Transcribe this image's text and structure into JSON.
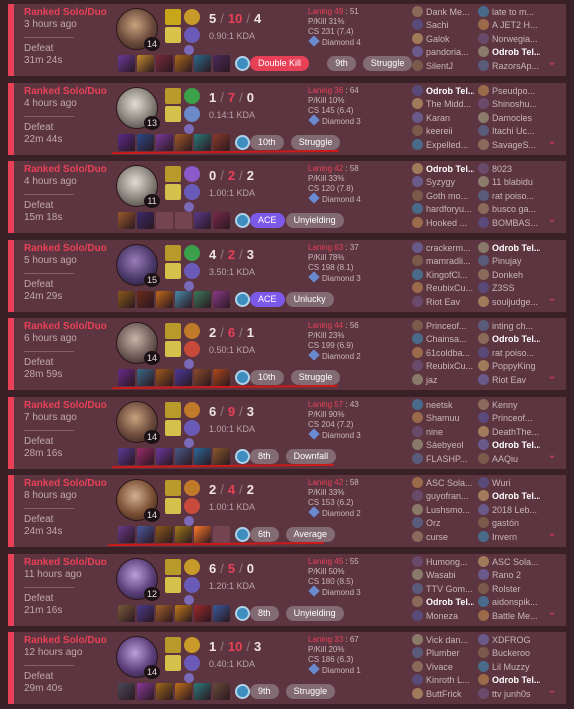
{
  "colors": {
    "loss_accent": "#e84057",
    "card_bg": "#5d3540",
    "ace_badge": "#7d59ea",
    "multikill_badge": "#e84057",
    "neutral_badge": "#826b72",
    "ward": "#3d8dbf",
    "annotation": "#cc1a1a"
  },
  "icons": {
    "expand": "chevron-down-icon",
    "ward": "ward-icon",
    "champion": "champion-portrait"
  },
  "matches": [
    {
      "queue": "Ranked Solo/Duo",
      "ago": "3 hours ago",
      "result": "Defeat",
      "duration": "31m 24s",
      "level": "14",
      "k": "5",
      "d": "10",
      "a": "4",
      "kda_ratio": "0.90:1 KDA",
      "laning_label": "Laning",
      "laning_a": "49",
      "laning_b": "51",
      "pkill": "P/Kill 31%",
      "cs": "CS 231 (7.4)",
      "rank": "Diamond 4",
      "badges": [
        {
          "text": "Double Kill",
          "style": "red"
        },
        {
          "text": "9th",
          "style": "gray"
        },
        {
          "text": "Struggle",
          "style": "gray"
        }
      ],
      "team1": [
        "Dank Me...",
        "Sachi",
        "Galok",
        "pandoria...",
        "SilentJ"
      ],
      "team2": [
        "late to m...",
        "A JET2 H...",
        "Norwegia...",
        "Odrob Tel...",
        "RazorsAp..."
      ]
    },
    {
      "queue": "Ranked Solo/Duo",
      "ago": "4 hours ago",
      "result": "Defeat",
      "duration": "22m 44s",
      "level": "13",
      "k": "1",
      "d": "7",
      "a": "0",
      "kda_ratio": "0.14:1 KDA",
      "laning_label": "Laning",
      "laning_a": "36",
      "laning_b": "64",
      "pkill": "P/Kill 10%",
      "cs": "CS 145 (6.4)",
      "rank": "Diamond 3",
      "badges": [
        {
          "text": "10th",
          "style": "gray"
        },
        {
          "text": "Struggle",
          "style": "gray"
        }
      ],
      "team1": [
        "Odrob Tel...",
        "The Midd...",
        "Karan",
        "keereii",
        "Expelled..."
      ],
      "team2": [
        "Pseudpo...",
        "Shinoshu...",
        "Damocles",
        "Itachi Uc...",
        "SavageS..."
      ]
    },
    {
      "queue": "Ranked Solo/Duo",
      "ago": "4 hours ago",
      "result": "Defeat",
      "duration": "15m 18s",
      "level": "11",
      "k": "0",
      "d": "2",
      "a": "2",
      "kda_ratio": "1.00:1 KDA",
      "laning_label": "Laning",
      "laning_a": "42",
      "laning_b": "58",
      "pkill": "P/Kill 33%",
      "cs": "CS 120 (7.8)",
      "rank": "Diamond 4",
      "badges": [
        {
          "text": "ACE",
          "style": "purple"
        },
        {
          "text": "Unyielding",
          "style": "gray"
        }
      ],
      "team1": [
        "Odrob Tel...",
        "Syzygy",
        "Goth mo...",
        "hardforyu...",
        "Hooked ..."
      ],
      "team2": [
        "8023",
        "11 blabidu",
        "rat poiso...",
        "busco ga...",
        "BOMBAS..."
      ]
    },
    {
      "queue": "Ranked Solo/Duo",
      "ago": "5 hours ago",
      "result": "Defeat",
      "duration": "24m 29s",
      "level": "15",
      "k": "4",
      "d": "2",
      "a": "3",
      "kda_ratio": "3.50:1 KDA",
      "laning_label": "Laning",
      "laning_a": "63",
      "laning_b": "37",
      "pkill": "P/Kill 78%",
      "cs": "CS 198 (8.1)",
      "rank": "Diamond 3",
      "badges": [
        {
          "text": "ACE",
          "style": "purple"
        },
        {
          "text": "Unlucky",
          "style": "gray"
        }
      ],
      "team1": [
        "crackerm...",
        "mamradli...",
        "KingofCl...",
        "ReubixCu...",
        "Riot Eav"
      ],
      "team2": [
        "Odrob Tel...",
        "Pinujay",
        "Donkeh",
        "Z3SS",
        "souljudge..."
      ]
    },
    {
      "queue": "Ranked Solo/Duo",
      "ago": "6 hours ago",
      "result": "Defeat",
      "duration": "28m 59s",
      "level": "14",
      "k": "2",
      "d": "6",
      "a": "1",
      "kda_ratio": "0.50:1 KDA",
      "laning_label": "Laning",
      "laning_a": "44",
      "laning_b": "56",
      "pkill": "P/Kill 23%",
      "cs": "CS 199 (6.9)",
      "rank": "Diamond 2",
      "badges": [
        {
          "text": "10th",
          "style": "gray"
        },
        {
          "text": "Struggle",
          "style": "gray"
        }
      ],
      "team1": [
        "Princeof...",
        "Chainsa...",
        "61coldba...",
        "ReubixCu...",
        "jaz"
      ],
      "team2": [
        "inting ch...",
        "Odrob Tel...",
        "rat poiso...",
        "PoppyKing",
        "Riot Eav"
      ]
    },
    {
      "queue": "Ranked Solo/Duo",
      "ago": "7 hours ago",
      "result": "Defeat",
      "duration": "28m 16s",
      "level": "14",
      "k": "6",
      "d": "9",
      "a": "3",
      "kda_ratio": "1.00:1 KDA",
      "laning_label": "Laning",
      "laning_a": "57",
      "laning_b": "43",
      "pkill": "P/Kill 90%",
      "cs": "CS 204 (7.2)",
      "rank": "Diamond 3",
      "badges": [
        {
          "text": "8th",
          "style": "gray"
        },
        {
          "text": "Downfall",
          "style": "gray"
        }
      ],
      "team1": [
        "neetsk",
        "Shamuu",
        "nine",
        "Sáebyeol",
        "FLASHP..."
      ],
      "team2": [
        "Kenny",
        "Princeof...",
        "DeathThe...",
        "Odrob Tel...",
        "AAQiu"
      ]
    },
    {
      "queue": "Ranked Solo/Duo",
      "ago": "8 hours ago",
      "result": "Defeat",
      "duration": "24m 34s",
      "level": "14",
      "k": "2",
      "d": "4",
      "a": "2",
      "kda_ratio": "1.00:1 KDA",
      "laning_label": "Laning",
      "laning_a": "42",
      "laning_b": "58",
      "pkill": "P/Kill 33%",
      "cs": "CS 153 (6.2)",
      "rank": "Diamond 2",
      "badges": [
        {
          "text": "6th",
          "style": "gray"
        },
        {
          "text": "Average",
          "style": "gray"
        }
      ],
      "team1": [
        "ASC Sola...",
        "guyofran...",
        "Lushsmo...",
        "Orz",
        "curse"
      ],
      "team2": [
        "Wuri",
        "Odrob Tel...",
        "2018 Leb...",
        "gastón",
        "Invern"
      ]
    },
    {
      "queue": "Ranked Solo/Duo",
      "ago": "11 hours ago",
      "result": "Defeat",
      "duration": "21m 16s",
      "level": "12",
      "k": "6",
      "d": "5",
      "a": "0",
      "kda_ratio": "1.20:1 KDA",
      "laning_label": "Laning",
      "laning_a": "45",
      "laning_b": "55",
      "pkill": "P/Kill 50%",
      "cs": "CS 180 (8.5)",
      "rank": "Diamond 3",
      "badges": [
        {
          "text": "8th",
          "style": "gray"
        },
        {
          "text": "Unyielding",
          "style": "gray"
        }
      ],
      "team1": [
        "Humong...",
        "Wasabi",
        "TTV Gom...",
        "Odrob Tel...",
        "Moneza"
      ],
      "team2": [
        "ASC Sola...",
        "Rano 2",
        "Rolster",
        "aidonspik...",
        "Battle Me..."
      ]
    },
    {
      "queue": "Ranked Solo/Duo",
      "ago": "12 hours ago",
      "result": "Defeat",
      "duration": "29m 40s",
      "level": "14",
      "k": "1",
      "d": "10",
      "a": "3",
      "kda_ratio": "0.40:1 KDA",
      "laning_label": "Laning",
      "laning_a": "33",
      "laning_b": "67",
      "pkill": "P/Kill 20%",
      "cs": "CS 186 (6.3)",
      "rank": "Diamond 1",
      "badges": [
        {
          "text": "9th",
          "style": "gray"
        },
        {
          "text": "Struggle",
          "style": "gray"
        }
      ],
      "team1": [
        "Vick dan...",
        "Plumber",
        "Vivace",
        "Kinroth L...",
        "ButtFrick"
      ],
      "team2": [
        "XDFROG",
        "Buckeroo",
        "Lil Muzzy",
        "Odrob Tel...",
        "ttv junh0s"
      ]
    }
  ]
}
